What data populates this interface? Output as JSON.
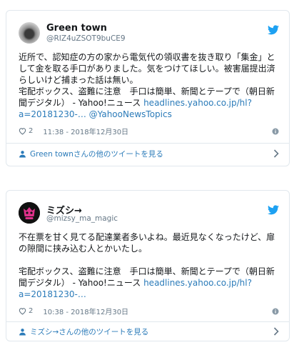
{
  "tweets": [
    {
      "name": "Green town",
      "handle": "@RIZ4uZSOT9buCE9",
      "text1": "近所で、認知症の方の家から電気代の領収書を抜き取り「集金」として金を取る手口がありました。気をつけてほしい。被害届提出済らしいけど捕まった話は無い。",
      "text2": "宅配ボックス、盗難に注意　手口は簡単、新聞とテープで（朝日新聞デジタル） - Yahoo!ニュース ",
      "link": "headlines.yahoo.co.jp/hl?a=20181230-…",
      "mention": "@YahooNewsTopics",
      "likes": "2",
      "timestamp": "11:38 - 2018年12月30日",
      "more_label": "Green townさんの他のツイートを見る",
      "icons": [
        "avatar",
        "twitter-bird-icon",
        "heart-icon",
        "info-icon",
        "person-icon",
        "chevron-right-icon"
      ]
    },
    {
      "name": "ミズシ→",
      "handle": "@mizsy_ma_magic",
      "text1": "不在票を甘く見てる配達業者多いよね。最近見なくなったけど、扉の隙間に挟み込む人とかいたし。",
      "text2": "宅配ボックス、盗難に注意　手口は簡単、新聞とテープで（朝日新聞デジタル） - Yahoo!ニュース ",
      "link": "headlines.yahoo.co.jp/hl?a=20181230-…",
      "likes": "2",
      "timestamp": "10:38 - 2018年12月30日",
      "more_label": "ミズシ→さんの他のツイートを見る",
      "icons": [
        "avatar",
        "twitter-bird-icon",
        "heart-icon",
        "info-icon",
        "person-icon",
        "chevron-right-icon"
      ]
    }
  ],
  "colors": {
    "link": "#2b7bb9",
    "twitter_blue": "#1da1f2",
    "text": "#14171a",
    "secondary": "#657786",
    "border": "#e1e8ed",
    "avatar2_accent": "#e0308a"
  }
}
